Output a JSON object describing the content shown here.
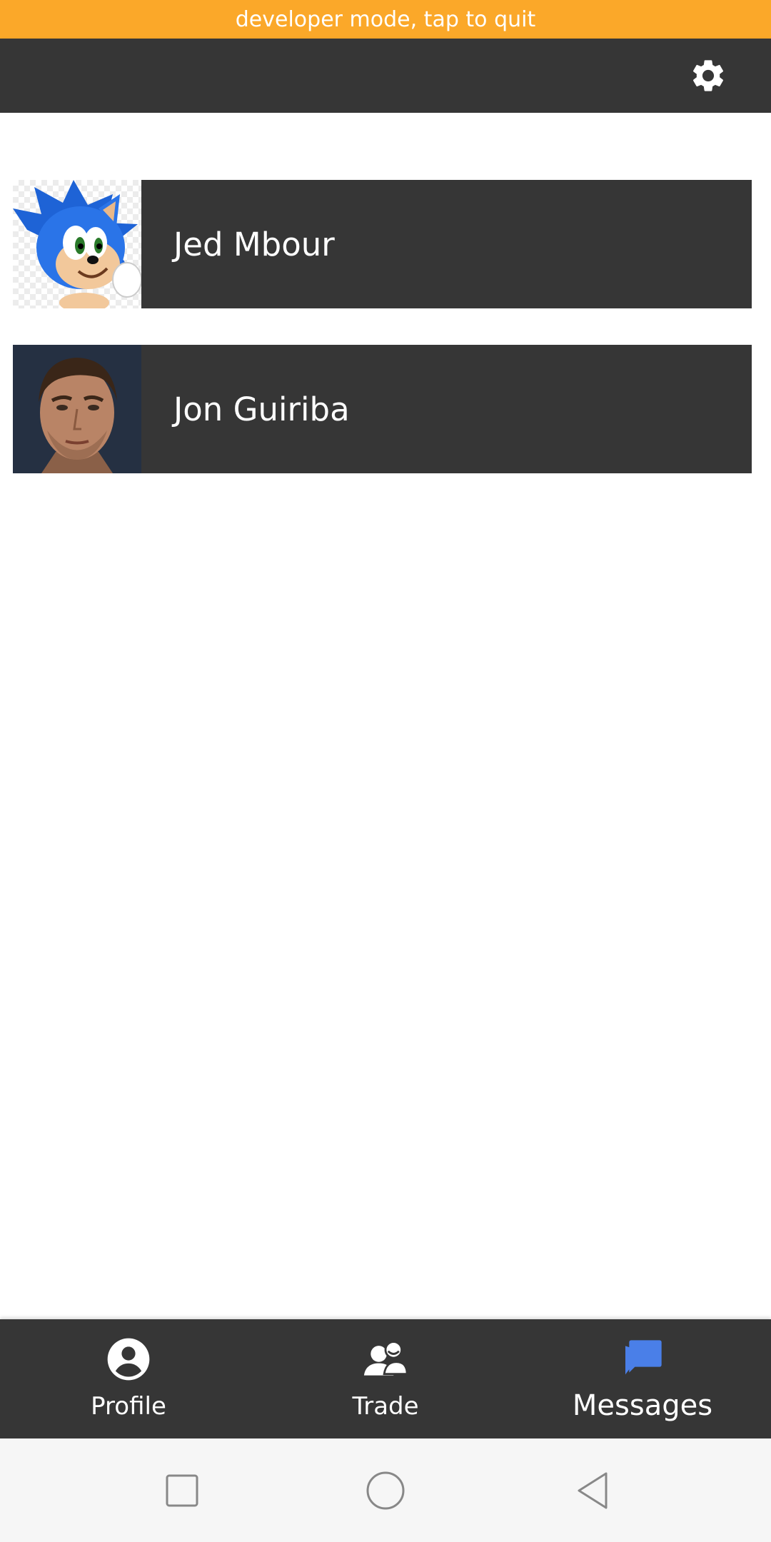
{
  "banner": {
    "text": "developer mode, tap to quit",
    "color": "#FBA829"
  },
  "appbar": {
    "settings_icon": "gear-icon"
  },
  "contacts": [
    {
      "name": "Jed Mbour",
      "avatar": "cartoon-hedgehog-avatar"
    },
    {
      "name": "Jon Guiriba",
      "avatar": "man-portrait-avatar"
    }
  ],
  "bottom_nav": {
    "items": [
      {
        "label": "Profile",
        "icon": "account-circle-icon",
        "active": false
      },
      {
        "label": "Trade",
        "icon": "people-chat-icon",
        "active": false
      },
      {
        "label": "Messages",
        "icon": "forum-icon",
        "active": true
      }
    ],
    "active_color": "#4A7FE8"
  },
  "system_nav": {
    "recent": "square-icon",
    "home": "circle-icon",
    "back": "triangle-back-icon"
  }
}
